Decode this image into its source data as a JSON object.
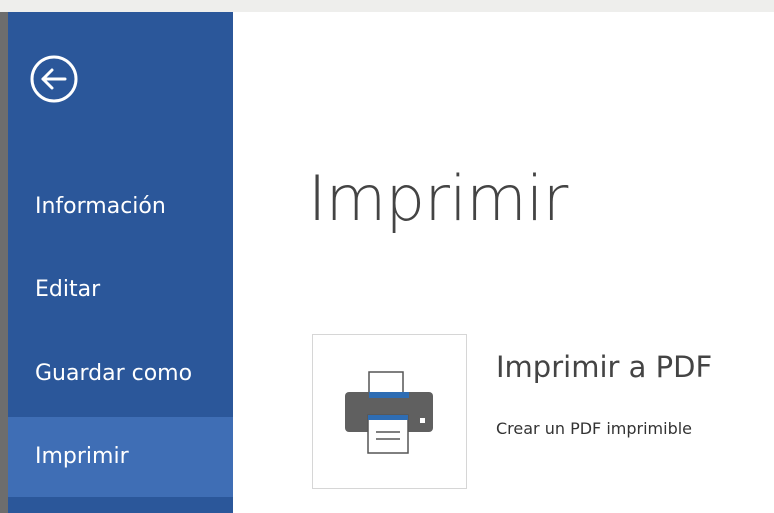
{
  "sidebar": {
    "back_icon": "arrow-left-circle-icon",
    "items": [
      {
        "label": "Información",
        "selected": false
      },
      {
        "label": "Editar",
        "selected": false
      },
      {
        "label": "Guardar como",
        "selected": false
      },
      {
        "label": "Imprimir",
        "selected": true
      }
    ]
  },
  "main": {
    "title": "Imprimir",
    "printer": {
      "icon": "printer-icon",
      "name": "Imprimir a PDF",
      "description": "Crear un PDF imprimible"
    }
  },
  "colors": {
    "sidebar_bg": "#2b579a",
    "sidebar_selected": "#3f6eb5",
    "printer_accent": "#2e6db4"
  }
}
